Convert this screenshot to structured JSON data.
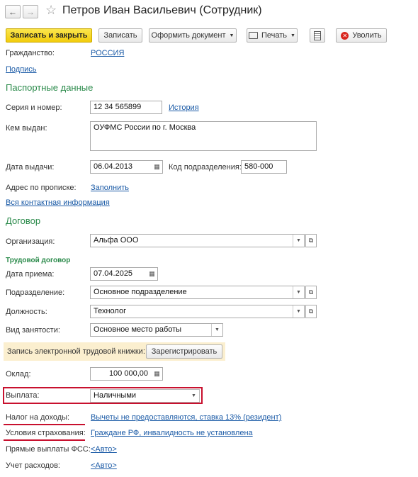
{
  "window": {
    "title": "Петров Иван Васильевич (Сотрудник)"
  },
  "toolbar": {
    "save_close": "Записать и закрыть",
    "save": "Записать",
    "create_doc": "Оформить документ",
    "print": "Печать",
    "dismiss": "Уволить"
  },
  "general": {
    "citizenship_label": "Гражданство:",
    "citizenship_value": "РОССИЯ",
    "signature_link": "Подпись"
  },
  "passport": {
    "section_title": "Паспортные данные",
    "series_label": "Серия и номер:",
    "series_value": "12 34 565899",
    "history_link": "История",
    "issued_by_label": "Кем выдан:",
    "issued_by_value": "ОУФМС России по г. Москва",
    "issue_date_label": "Дата выдачи:",
    "issue_date_value": "06.04.2013",
    "dept_code_label": "Код подразделения:",
    "dept_code_value": "580-000",
    "address_label": "Адрес по прописке:",
    "address_link": "Заполнить",
    "all_contacts_link": "Вся контактная информация"
  },
  "contract": {
    "section_title": "Договор",
    "organization_label": "Организация:",
    "organization_value": "Альфа ООО",
    "employment_subtitle": "Трудовой договор",
    "hire_date_label": "Дата приема:",
    "hire_date_value": "07.04.2025",
    "department_label": "Подразделение:",
    "department_value": "Основное подразделение",
    "position_label": "Должность:",
    "position_value": "Технолог",
    "employment_type_label": "Вид занятости:",
    "employment_type_value": "Основное место работы",
    "ewb_label": "Запись электронной трудовой книжки:",
    "ewb_button": "Зарегистрировать",
    "salary_label": "Оклад:",
    "salary_value": "100 000,00",
    "payout_label": "Выплата:",
    "payout_value": "Наличными",
    "tax_label": "Налог на доходы:",
    "tax_link": "Вычеты не предоставляются, ставка 13% (резидент)",
    "insurance_label": "Условия страхования:",
    "insurance_link": "Граждане РФ, инвалидность не установлена",
    "fss_label": "Прямые выплаты ФСС:",
    "fss_link": "<Авто>",
    "expense_label": "Учет расходов:",
    "expense_link": "<Авто>"
  },
  "colors": {
    "section": "#2a8a4a",
    "link": "#1a5aa6",
    "highlight": "#c8102e",
    "primary_button": "#f5d315"
  }
}
